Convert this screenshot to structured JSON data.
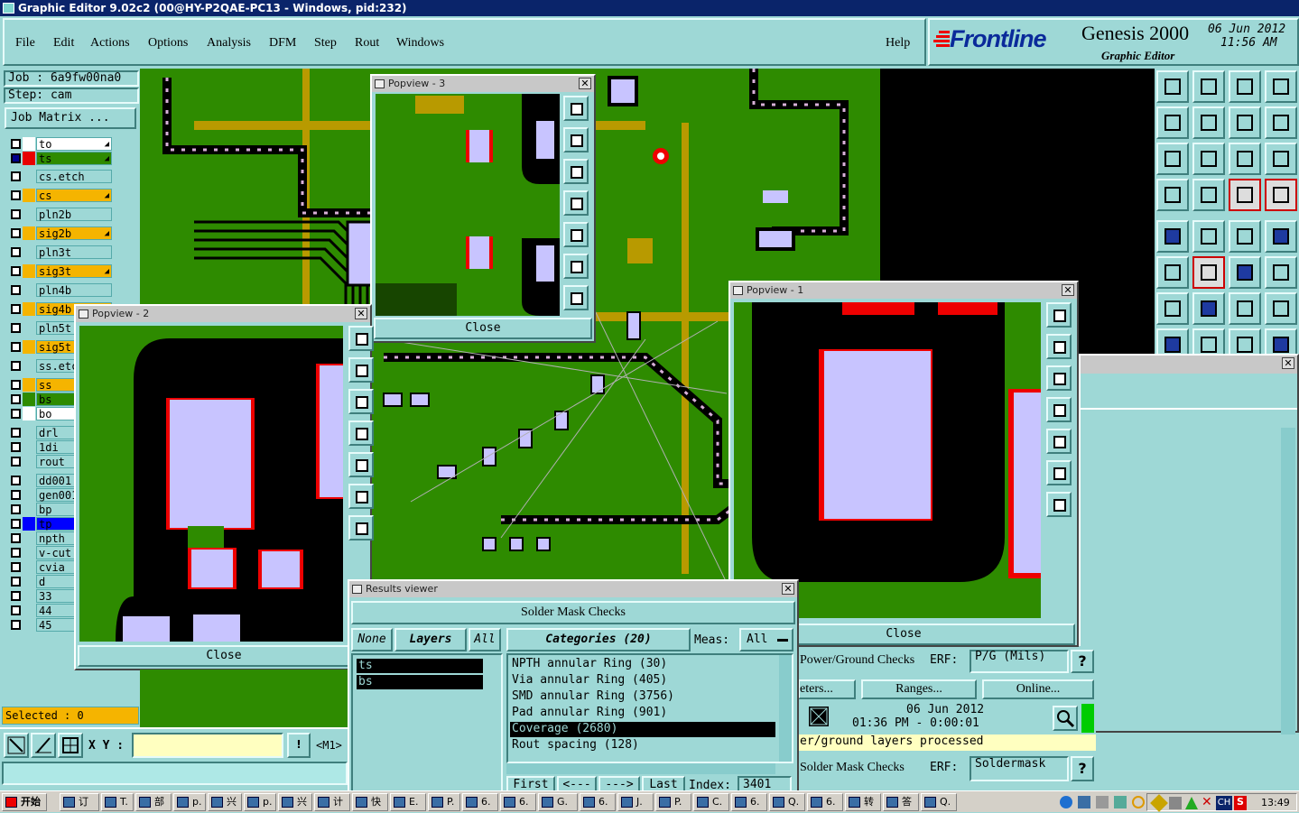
{
  "window": {
    "title": "Graphic Editor 9.02c2 (00@HY-P2QAE-PC13 - Windows, pid:232)"
  },
  "menu": {
    "items": [
      "File",
      "Edit",
      "Actions",
      "Options",
      "Analysis",
      "DFM",
      "Step",
      "Rout",
      "Windows"
    ],
    "help": "Help"
  },
  "brand": {
    "logo": "Frontline",
    "product": "Genesis 2000",
    "subtitle": "Graphic Editor",
    "date": "06 Jun 2012",
    "time": "11:56 AM"
  },
  "job": {
    "job_label": "Job :  6a9fw00na0",
    "step_label": "Step: cam",
    "matrix_button": "Job Matrix ..."
  },
  "layers": [
    {
      "name": "to",
      "color": "#ffffff",
      "on": false,
      "mark": true
    },
    {
      "name": "ts",
      "color": "#e80000",
      "on": true,
      "mark": true
    },
    {
      "name": "cs.etch",
      "color": "#9ed8d6",
      "on": false,
      "mark": false
    },
    {
      "name": "cs",
      "color": "#f5b400",
      "on": false,
      "mark": true
    },
    {
      "name": "pln2b",
      "color": "#9ed8d6",
      "on": false,
      "mark": false
    },
    {
      "name": "sig2b",
      "color": "#f5b400",
      "on": false,
      "mark": true
    },
    {
      "name": "pln3t",
      "color": "#9ed8d6",
      "on": false,
      "mark": false
    },
    {
      "name": "sig3t",
      "color": "#f5b400",
      "on": false,
      "mark": true
    },
    {
      "name": "pln4b",
      "color": "#9ed8d6",
      "on": false,
      "mark": false
    },
    {
      "name": "sig4b",
      "color": "#f5b400",
      "on": false,
      "mark": false
    },
    {
      "name": "pln5t",
      "color": "#9ed8d6",
      "on": false,
      "mark": false
    },
    {
      "name": "sig5t",
      "color": "#f5b400",
      "on": false,
      "mark": false
    },
    {
      "name": "ss.etch",
      "color": "#9ed8d6",
      "on": false,
      "mark": false
    },
    {
      "name": "ss",
      "color": "#f5b400",
      "on": false,
      "mark": false
    },
    {
      "name": "bs",
      "color": "#2e8b00",
      "on": false,
      "mark": false
    },
    {
      "name": "bo",
      "color": "#ffffff",
      "on": false,
      "mark": false
    },
    {
      "name": "drl",
      "color": "#9ed8d6",
      "on": false,
      "mark": false
    },
    {
      "name": "1di",
      "color": "#9ed8d6",
      "on": false,
      "mark": false
    },
    {
      "name": "rout",
      "color": "#9ed8d6",
      "on": false,
      "mark": false
    },
    {
      "name": "dd001",
      "color": "#9ed8d6",
      "on": false,
      "mark": false
    },
    {
      "name": "gen001",
      "color": "#9ed8d6",
      "on": false,
      "mark": false
    },
    {
      "name": "bp",
      "color": "#9ed8d6",
      "on": false,
      "mark": false
    },
    {
      "name": "tp",
      "color": "#0000ff",
      "on": false,
      "mark": false
    },
    {
      "name": "npth",
      "color": "#9ed8d6",
      "on": false,
      "mark": false
    },
    {
      "name": "v-cut",
      "color": "#9ed8d6",
      "on": false,
      "mark": false
    },
    {
      "name": "cvia",
      "color": "#9ed8d6",
      "on": false,
      "mark": false
    },
    {
      "name": "d",
      "color": "#9ed8d6",
      "on": false,
      "mark": false
    },
    {
      "name": "33",
      "color": "#9ed8d6",
      "on": false,
      "mark": false
    },
    {
      "name": "44",
      "color": "#9ed8d6",
      "on": false,
      "mark": false
    },
    {
      "name": "45",
      "color": "#9ed8d6",
      "on": false,
      "mark": false
    }
  ],
  "status": {
    "selected": "Selected : 0",
    "xy_label": "X Y :",
    "xy_value": "",
    "m1": "<M1>"
  },
  "popviews": {
    "pv3": {
      "title": "Popview - 3",
      "close": "Close"
    },
    "pv2": {
      "title": "Popview - 2",
      "close": "Close"
    },
    "pv1": {
      "title": "Popview - 1",
      "close": "Close"
    }
  },
  "results": {
    "title": "Results viewer",
    "header": "Solder Mask Checks",
    "none": "None",
    "layers": "Layers",
    "all": "All",
    "categories_label": "Categories (20)",
    "meas_label": "Meas:",
    "meas_value": "All",
    "layer_items": [
      "ts",
      "bs"
    ],
    "category_items": [
      "NPTH annular Ring (30)",
      "Via annular Ring (405)",
      "SMD annular Ring (3756)",
      "Pad annular Ring (901)",
      "Coverage (2680)",
      "Rout spacing (128)"
    ],
    "selected_category": 4,
    "nav": [
      "First",
      "<---",
      "--->",
      "Last"
    ],
    "index_label": "Index:",
    "index_value": "3401"
  },
  "checks_panel": {
    "pg_label": "Power/Ground Checks",
    "erf": "ERF:",
    "pg_value": "P/G (Mils)",
    "params": "eters...",
    "ranges": "Ranges...",
    "online": "Online...",
    "run_date": "06 Jun 2012",
    "run_time": "01:36 PM - 0:00:01",
    "processed": "er/ground layers processed",
    "sm_label": "Solder Mask Checks",
    "sm_erf": "ERF:",
    "sm_value": "Soldermask",
    "q": "?"
  },
  "taskbar": {
    "start": "开始",
    "tasks": [
      "订",
      "T.",
      "部",
      "p.",
      "兴",
      "p.",
      "兴",
      "计",
      "快",
      "E.",
      "P.",
      "6.",
      "6.",
      "G.",
      "6.",
      "J.",
      "P.",
      "C.",
      "6.",
      "Q.",
      "6.",
      "转",
      "答",
      "Q."
    ],
    "clock": "13:49",
    "lang": "CH"
  }
}
